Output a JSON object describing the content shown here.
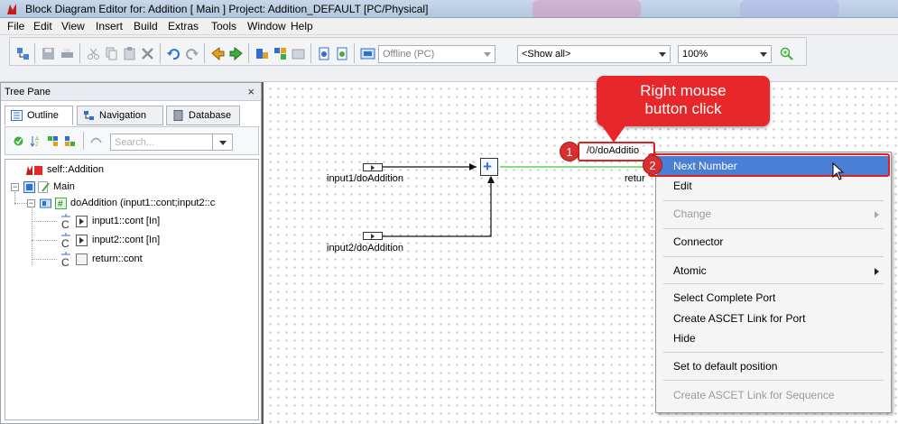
{
  "window": {
    "title": "Block Diagram Editor for: Addition [ Main ] Project: Addition_DEFAULT [PC/Physical]"
  },
  "menubar": {
    "items": [
      "File",
      "Edit",
      "View",
      "Insert",
      "Build",
      "Extras",
      "Tools",
      "Window",
      "Help"
    ]
  },
  "toolbar": {
    "mode_combo": "Offline (PC)",
    "show_combo": "<Show all>",
    "zoom_combo": "100%"
  },
  "tree_pane": {
    "title": "Tree Pane",
    "close": "×",
    "tabs": [
      "Outline",
      "Navigation",
      "Database"
    ],
    "search_placeholder": "Search...",
    "nodes": [
      "self::Addition",
      "Main",
      "doAddition (input1::cont;input2::c",
      "input1::cont [In]",
      "input2::cont [In]",
      "return::cont"
    ]
  },
  "diagram": {
    "input1_label": "input1/doAddition",
    "input2_label": "input2/doAddition",
    "output_label_partial": "/0/doAdditio",
    "return_label_partial": "retur"
  },
  "callout": {
    "line1": "Right mouse",
    "line2": "button click",
    "step1": "1",
    "step2": "2"
  },
  "context_menu": {
    "items": [
      {
        "label": "Next Number",
        "state": "selected"
      },
      {
        "label": "Edit",
        "state": "normal"
      },
      {
        "label": "Change",
        "state": "disabled"
      },
      {
        "label": "Connector",
        "state": "normal"
      },
      {
        "label": "Atomic",
        "state": "normal"
      },
      {
        "label": "Select Complete Port",
        "state": "normal"
      },
      {
        "label": "Create ASCET Link for Port",
        "state": "normal"
      },
      {
        "label": "Hide",
        "state": "normal"
      },
      {
        "label": "Set to default position",
        "state": "normal"
      },
      {
        "label": "Create ASCET Link for Sequence",
        "state": "disabled"
      }
    ]
  },
  "colors": {
    "selection": "#4a7fd6",
    "callout": "#e8272a",
    "highlight": "#e02020",
    "wire_output": "#3cc43c"
  }
}
